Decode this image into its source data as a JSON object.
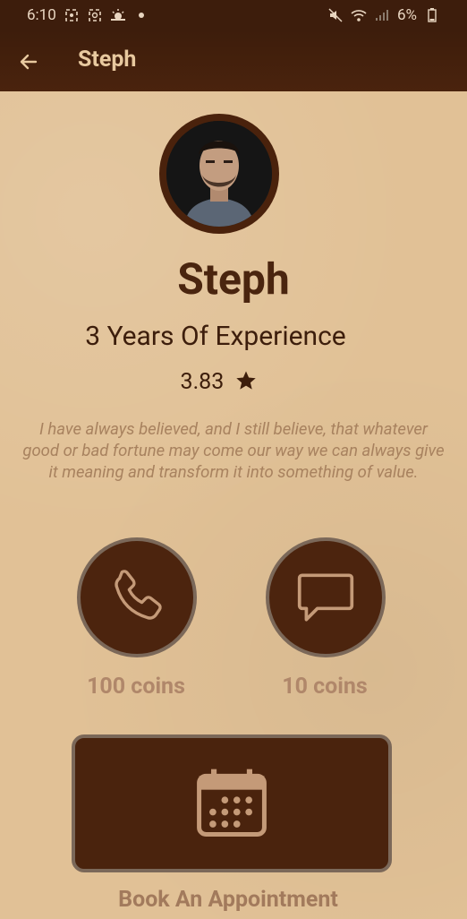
{
  "status_bar": {
    "time": "6:10",
    "battery": "6%"
  },
  "app_bar": {
    "title": "Steph"
  },
  "profile": {
    "name": "Steph",
    "experience": "3 Years Of Experience",
    "rating": "3.83",
    "bio": "I have always believed, and I still believe, that whatever good or bad fortune may come our way we can always give it meaning and transform it into something of value."
  },
  "actions": {
    "call_coins": "100 coins",
    "chat_coins": "10 coins",
    "book_label": "Book An Appointment"
  },
  "colors": {
    "primary_dark": "#4a230d",
    "background": "#e1c196",
    "icon_accent": "#c49a78"
  }
}
